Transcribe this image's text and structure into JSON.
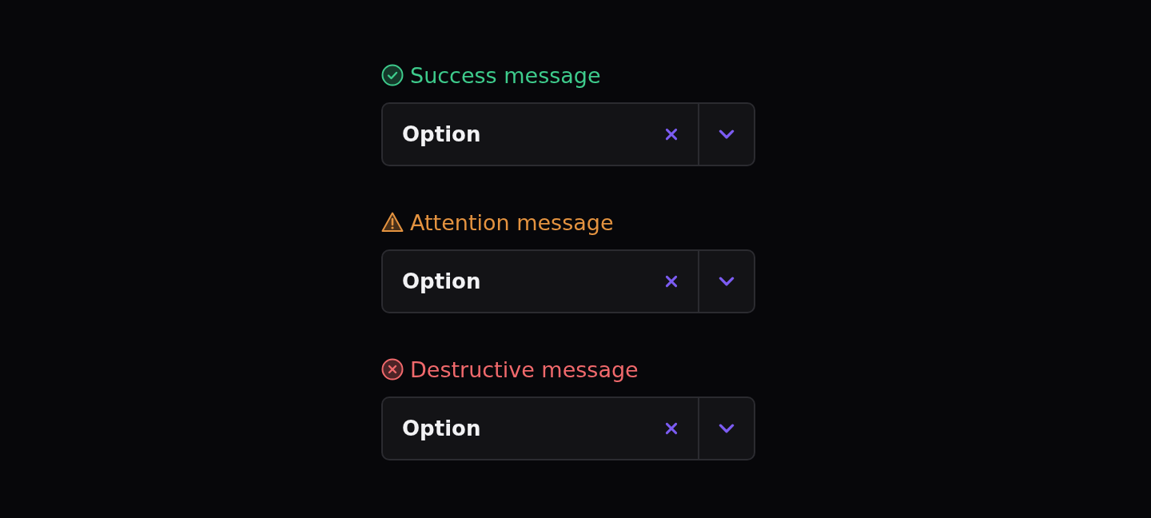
{
  "fields": [
    {
      "message": {
        "kind": "success",
        "text": "Success message"
      },
      "value": "Option"
    },
    {
      "message": {
        "kind": "attention",
        "text": "Attention message"
      },
      "value": "Option"
    },
    {
      "message": {
        "kind": "destructive",
        "text": "Destructive message"
      },
      "value": "Option"
    }
  ]
}
